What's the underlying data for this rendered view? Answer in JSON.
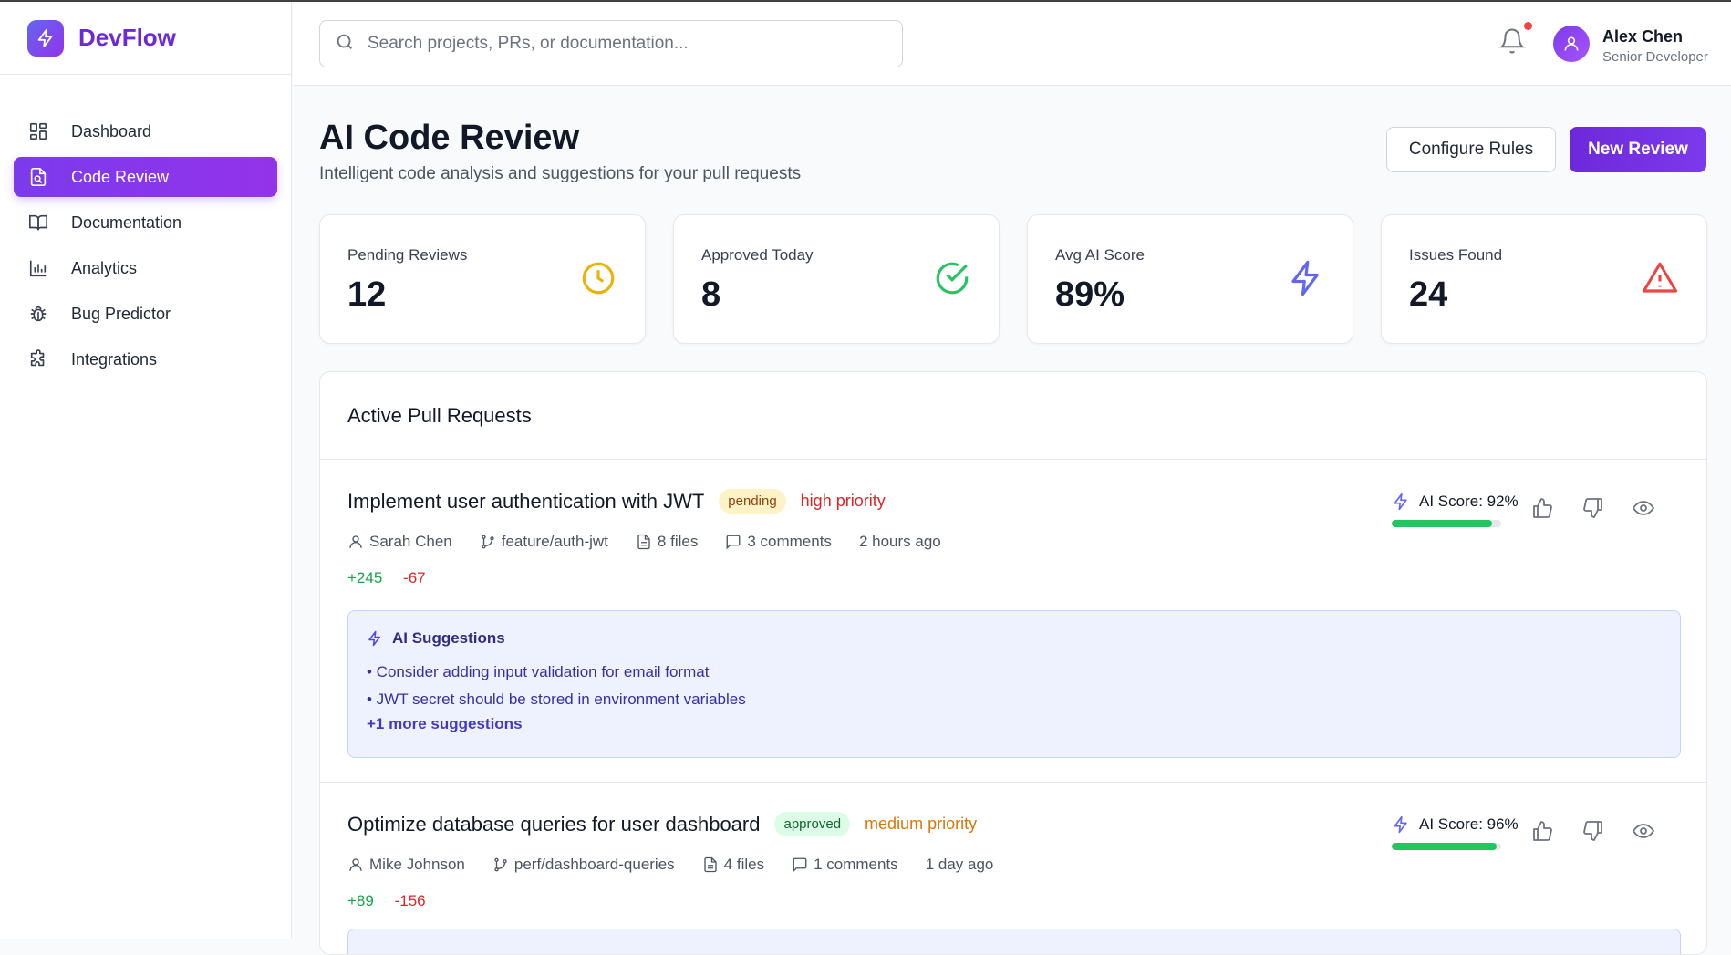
{
  "app": {
    "name": "DevFlow"
  },
  "sidebar": {
    "items": [
      {
        "label": "Dashboard",
        "icon": "grid-icon",
        "active": false
      },
      {
        "label": "Code Review",
        "icon": "file-search-icon",
        "active": true
      },
      {
        "label": "Documentation",
        "icon": "book-icon",
        "active": false
      },
      {
        "label": "Analytics",
        "icon": "bar-chart-icon",
        "active": false
      },
      {
        "label": "Bug Predictor",
        "icon": "bug-icon",
        "active": false
      },
      {
        "label": "Integrations",
        "icon": "puzzle-icon",
        "active": false
      }
    ]
  },
  "header": {
    "search_placeholder": "Search projects, PRs, or documentation...",
    "user": {
      "name": "Alex Chen",
      "role": "Senior Developer"
    },
    "has_notification": true
  },
  "page": {
    "title": "AI Code Review",
    "subtitle": "Intelligent code analysis and suggestions for your pull requests",
    "configure_label": "Configure Rules",
    "new_review_label": "New Review"
  },
  "stats": [
    {
      "label": "Pending Reviews",
      "value": "12",
      "icon": "clock-icon",
      "color": "#eab308"
    },
    {
      "label": "Approved Today",
      "value": "8",
      "icon": "check-circle-icon",
      "color": "#22c55e"
    },
    {
      "label": "Avg AI Score",
      "value": "89%",
      "icon": "lightning-icon",
      "color": "#6366f1"
    },
    {
      "label": "Issues Found",
      "value": "24",
      "icon": "warning-triangle-icon",
      "color": "#ef4444"
    }
  ],
  "pr_panel": {
    "title": "Active Pull Requests",
    "items": [
      {
        "title": "Implement user authentication with JWT",
        "status": "pending",
        "priority": "high priority",
        "author": "Sarah Chen",
        "branch": "feature/auth-jwt",
        "files": "8 files",
        "comments": "3 comments",
        "time": "2 hours ago",
        "additions": "+245",
        "deletions": "-67",
        "ai_score_label": "AI Score: 92%",
        "ai_score": 0.92,
        "suggestions_title": "AI Suggestions",
        "suggestions": [
          "• Consider adding input validation for email format",
          "• JWT secret should be stored in environment variables"
        ],
        "more_suggestions": "+1 more suggestions"
      },
      {
        "title": "Optimize database queries for user dashboard",
        "status": "approved",
        "priority": "medium priority",
        "author": "Mike Johnson",
        "branch": "perf/dashboard-queries",
        "files": "4 files",
        "comments": "1 comments",
        "time": "1 day ago",
        "additions": "+89",
        "deletions": "-156",
        "ai_score_label": "AI Score: 96%",
        "ai_score": 0.96
      }
    ]
  },
  "colors": {
    "brand": "#6d28d9",
    "accent": "#7c3aed",
    "success": "#22c55e",
    "danger": "#dc2626",
    "warning": "#d97706"
  }
}
